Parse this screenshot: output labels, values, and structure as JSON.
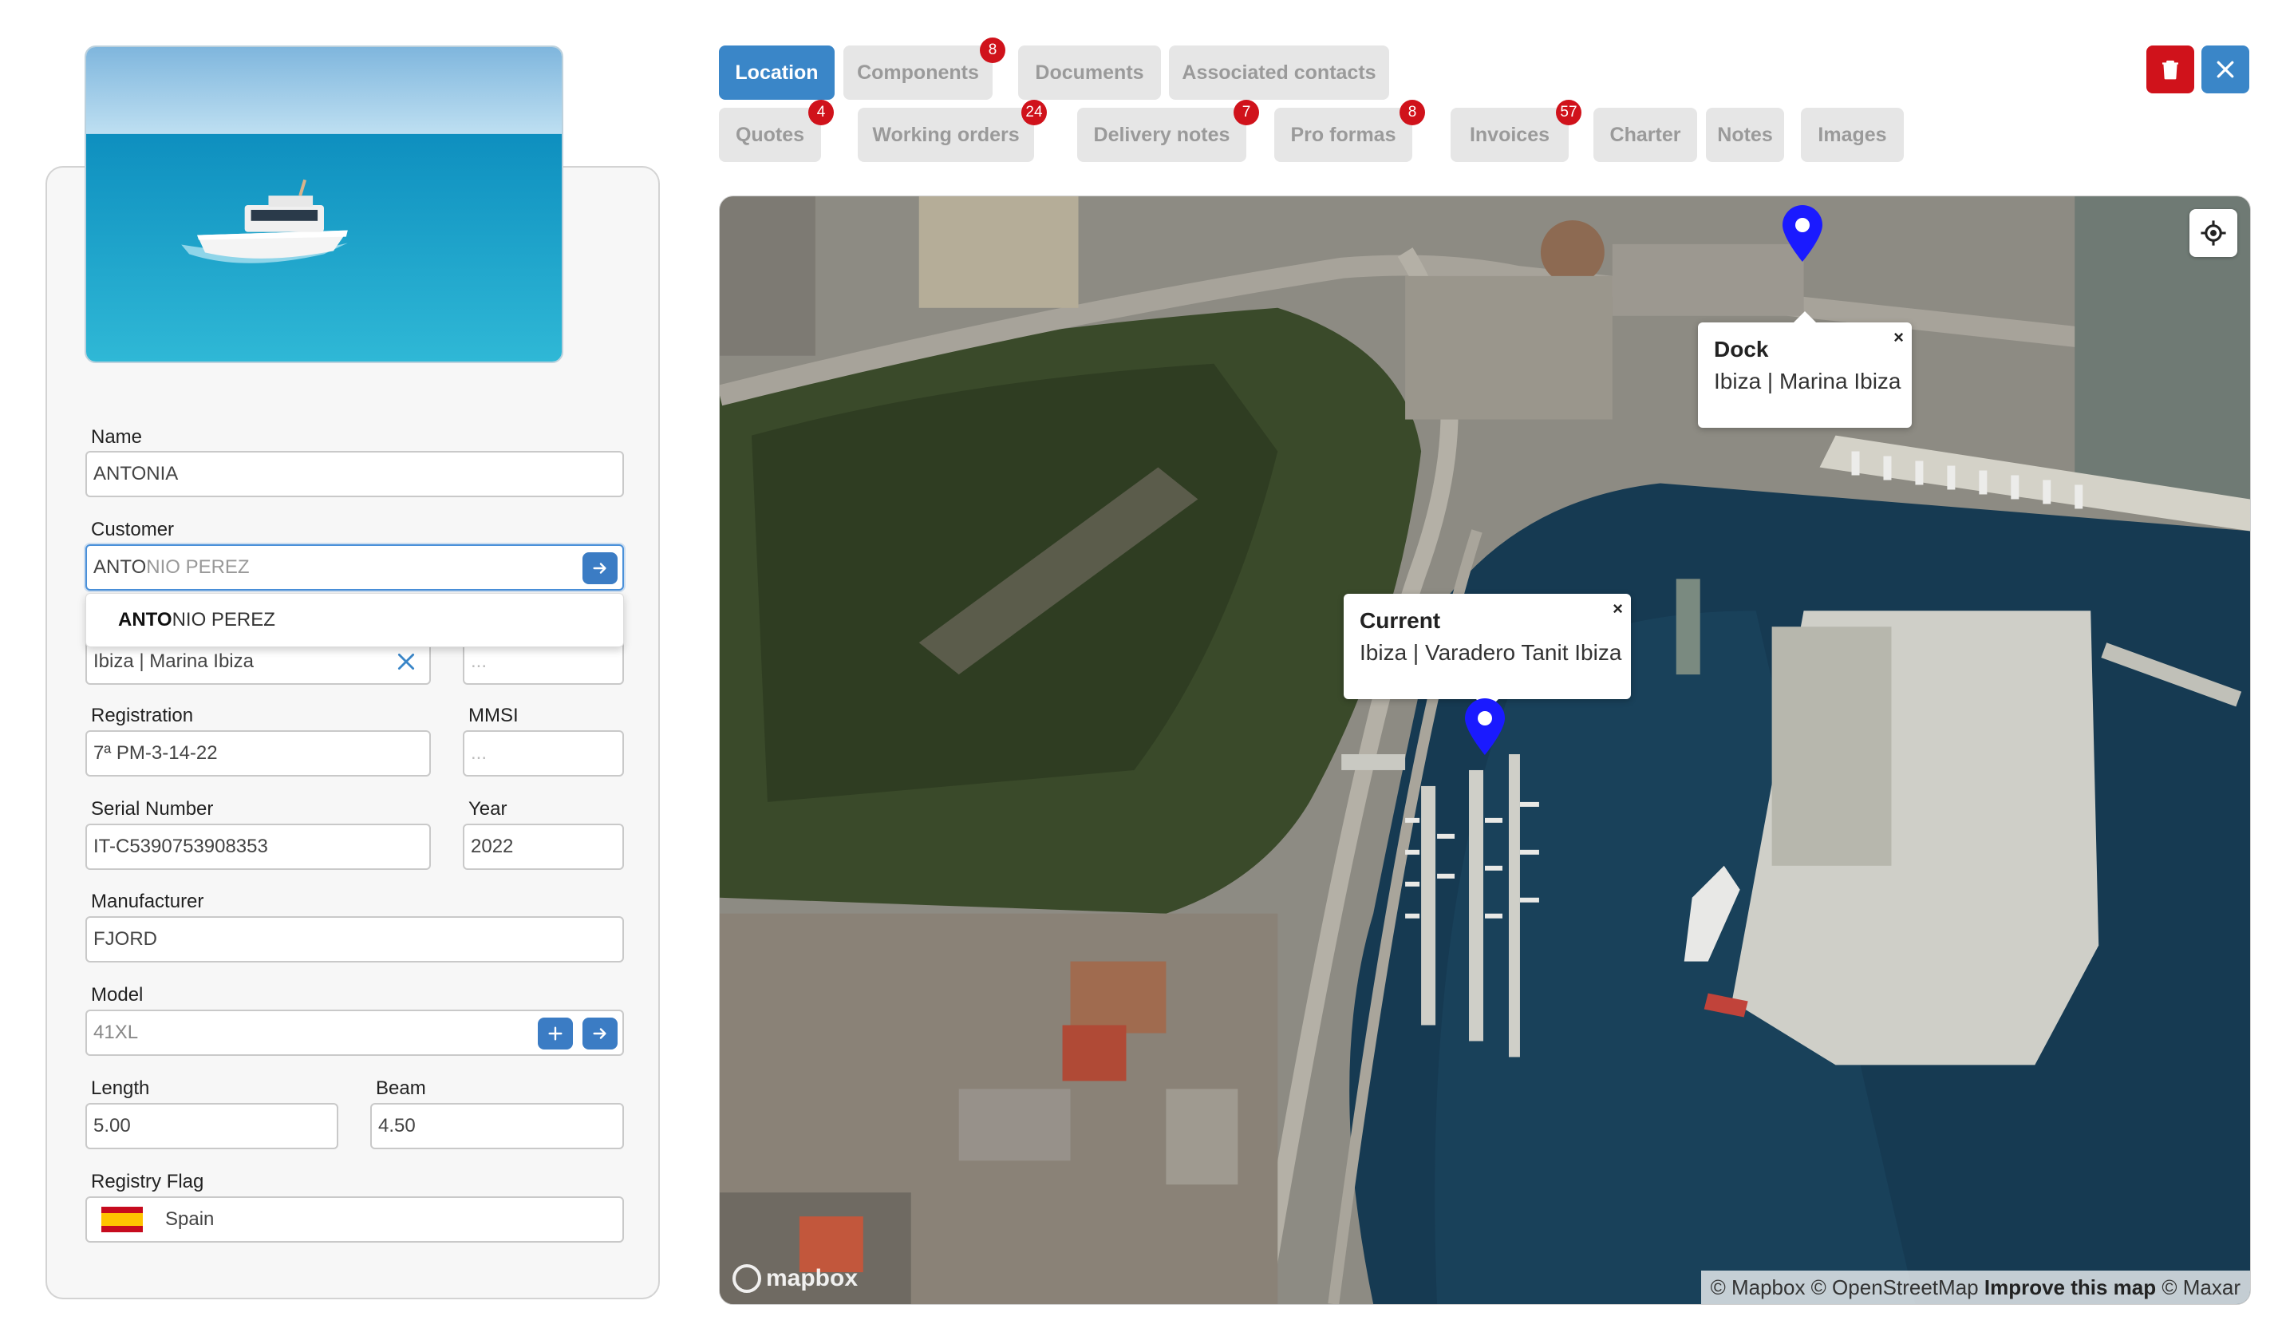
{
  "tabs": [
    {
      "label": "Location",
      "active": true
    },
    {
      "label": "Components",
      "badge": "8"
    },
    {
      "label": "Documents"
    },
    {
      "label": "Associated contacts"
    },
    {
      "label": "Quotes",
      "badge": "4"
    },
    {
      "label": "Working orders",
      "badge": "24"
    },
    {
      "label": "Delivery notes",
      "badge": "7"
    },
    {
      "label": "Pro formas",
      "badge": "8"
    },
    {
      "label": "Invoices",
      "badge": "57"
    },
    {
      "label": "Charter"
    },
    {
      "label": "Notes"
    },
    {
      "label": "Images"
    }
  ],
  "form": {
    "name_label": "Name",
    "name_value": "ANTONIA",
    "customer_label": "Customer",
    "customer_typed": "ANTO",
    "customer_suggest": "NIO PEREZ",
    "dropdown_match": "ANTO",
    "dropdown_rest": "NIO PEREZ",
    "dock_value": "Ibiza | Marina Ibiza",
    "dock_side_placeholder": "...",
    "registration_label": "Registration",
    "registration_value": "7ª PM-3-14-22",
    "mmsi_label": "MMSI",
    "mmsi_placeholder": "...",
    "serial_label": "Serial Number",
    "serial_value": "IT-C5390753908353",
    "year_label": "Year",
    "year_value": "2022",
    "manufacturer_label": "Manufacturer",
    "manufacturer_value": "FJORD",
    "model_label": "Model",
    "model_value": "41XL",
    "length_label": "Length",
    "length_value": "5.00",
    "beam_label": "Beam",
    "beam_value": "4.50",
    "flag_label": "Registry Flag",
    "flag_value": "Spain"
  },
  "map": {
    "dock_popup_title": "Dock",
    "dock_popup_sub": "Ibiza | Marina Ibiza",
    "current_popup_title": "Current",
    "current_popup_sub": "Ibiza | Varadero Tanit Ibiza",
    "popup_close": "×",
    "logo_text": "mapbox",
    "attribution_pre": "© Mapbox © OpenStreetMap",
    "attribution_link": "Improve this map",
    "attribution_post": "© Maxar"
  },
  "colors": {
    "accent": "#3a86c8",
    "danger": "#d0121b",
    "marker": "#1a1aff"
  }
}
